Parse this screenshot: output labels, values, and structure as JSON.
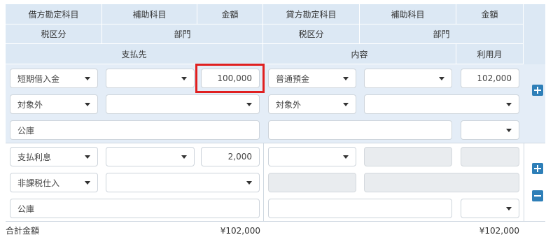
{
  "header": {
    "row1": {
      "debit_account": "借方勘定科目",
      "debit_sub": "補助科目",
      "debit_amount": "金額",
      "credit_account": "貸方勘定科目",
      "credit_sub": "補助科目",
      "credit_amount": "金額"
    },
    "row2": {
      "debit_tax": "税区分",
      "debit_dept": "部門",
      "credit_tax": "税区分",
      "credit_dept": "部門"
    },
    "row3": {
      "payee": "支払先",
      "content": "内容",
      "usage_month": "利用月"
    }
  },
  "entries": [
    {
      "debit_account": "短期借入金",
      "debit_sub": "",
      "debit_amount": "100,000",
      "credit_account": "普通預金",
      "credit_sub": "",
      "credit_amount": "102,000",
      "debit_tax": "対象外",
      "debit_dept": "",
      "credit_tax": "対象外",
      "credit_dept": "",
      "payee": "公庫",
      "content": "",
      "usage_month": ""
    },
    {
      "debit_account": "支払利息",
      "debit_sub": "",
      "debit_amount": "2,000",
      "credit_account": "",
      "credit_sub": "",
      "credit_amount": "",
      "debit_tax": "非課税仕入",
      "debit_dept": "",
      "credit_tax": "",
      "credit_dept": "",
      "payee": "公庫",
      "content": "",
      "usage_month": ""
    }
  ],
  "totals": {
    "label": "合計金額",
    "debit_total": "¥102,000",
    "credit_total": "¥102,000"
  },
  "icons": {
    "add": "plus-icon",
    "remove": "minus-icon",
    "dropdown": "chevron-down-icon"
  },
  "colors": {
    "header_bg": "#dce8f4",
    "row_band": "#e4edf7",
    "button": "#2e7fb8",
    "highlight": "#e02020"
  }
}
